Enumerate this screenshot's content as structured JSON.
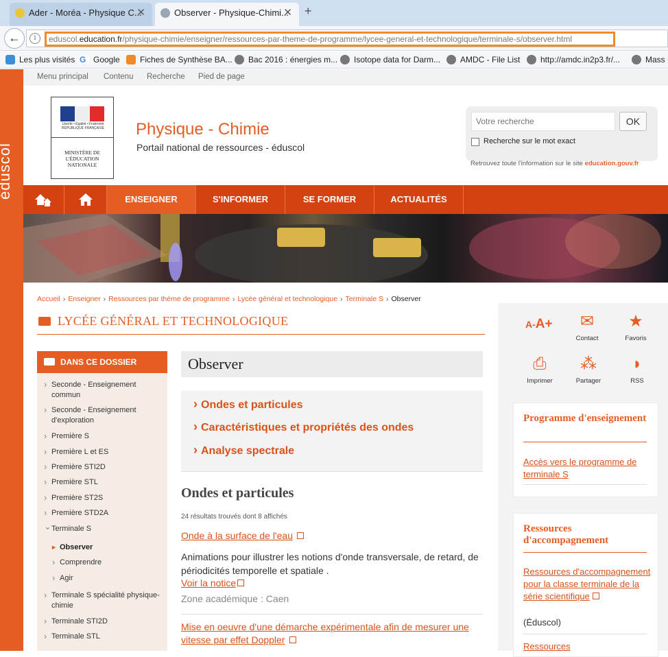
{
  "browser": {
    "tabs": [
      {
        "label": "Ader - Moréa - Physique C...",
        "active": false
      },
      {
        "label": "Observer - Physique-Chimi...",
        "active": true
      }
    ],
    "new_tab": "+",
    "url_host_pre": "eduscol.",
    "url_host": "education.fr",
    "url_path": "/physique-chimie/enseigner/ressources-par-theme-de-programme/lycee-general-et-technologique/terminale-s/observer.html",
    "bookmarks": [
      "Les plus visités",
      "Google",
      "Fiches de Synthèse BA...",
      "Bac 2016 : énergies m...",
      "Isotope data for Darm...",
      "AMDC - File List",
      "http://amdc.in2p3.fr/...",
      "Mass E"
    ]
  },
  "site": {
    "left_logo": "éduscol",
    "top_links": [
      "Menu principal",
      "Contenu",
      "Recherche",
      "Pied de page"
    ],
    "republique": "Liberté • Égalité • Fraternité RÉPUBLIQUE FRANÇAISE",
    "ministere": "MINISTÈRE DE L'ÉDUCATION NATIONALE",
    "title": "Physique - Chimie",
    "subtitle": "Portail national de ressources - éduscol",
    "search_placeholder": "Votre recherche",
    "ok": "OK",
    "exact_label": "Recherche sur le mot exact",
    "retrouvez": "Retrouvez toute l'information sur le site ",
    "retrouvez_link": "education.gouv.fr",
    "nav": [
      "ENSEIGNER",
      "S'INFORMER",
      "SE FORMER",
      "ACTUALITÉS"
    ],
    "breadcrumb": [
      "Accueil",
      "Enseigner",
      "Ressources par thème de programme",
      "Lycée général et technologique",
      "Terminale S",
      "Observer"
    ],
    "section_title": "LYCÉE GÉNÉRAL ET TECHNOLOGIQUE"
  },
  "sidebar": {
    "heading": "DANS CE DOSSIER",
    "items": [
      "Seconde - Enseignement commun",
      "Seconde - Enseignement d'exploration",
      "Première S",
      "Première L et ES",
      "Première STI2D",
      "Première STL",
      "Première ST2S",
      "Première STD2A",
      "Terminale S",
      "Observer",
      "Comprendre",
      "Agir",
      "Terminale S spécialité physique-chimie",
      "Terminale STI2D",
      "Terminale STL"
    ]
  },
  "main": {
    "heading": "Observer",
    "themes": [
      "Ondes et particules",
      "Caractéristiques et propriétés des ondes",
      "Analyse spectrale"
    ],
    "section": "Ondes et particules",
    "count": "24 résultats trouvés dont 8 affichés",
    "r1_title": "Onde à la surface de l'eau",
    "r1_desc": "Animations pour illustrer les notions d'onde transversale, de retard, de périodicités temporelle et spatiale .",
    "r1_link": "Voir la notice",
    "r1_zone": "Zone académique : Caen",
    "r2_title": "Mise en oeuvre d'une démarche expérimentale afin de mesurer une vitesse par effet Doppler"
  },
  "tools": {
    "aa_small": "A-",
    "aa_big": "A+",
    "contact": "Contact",
    "favoris": "Favoris",
    "imprimer": "Imprimer",
    "partager": "Partager",
    "rss": "RSS"
  },
  "cards": {
    "c1_title": "Programme d'enseignement",
    "c1_link": "Accès vers le programme de terminale S",
    "c2_title": "Ressources d'accompagnement",
    "c2_link": "Ressources d'accompagnement pour la classe terminale de la série scientifique",
    "c2_note": "(Éduscol)",
    "c3_title": "Ressources"
  },
  "colors": {
    "accent": "#e55d22",
    "nav": "#d44211",
    "url_highlight": "#ee8a2a"
  }
}
